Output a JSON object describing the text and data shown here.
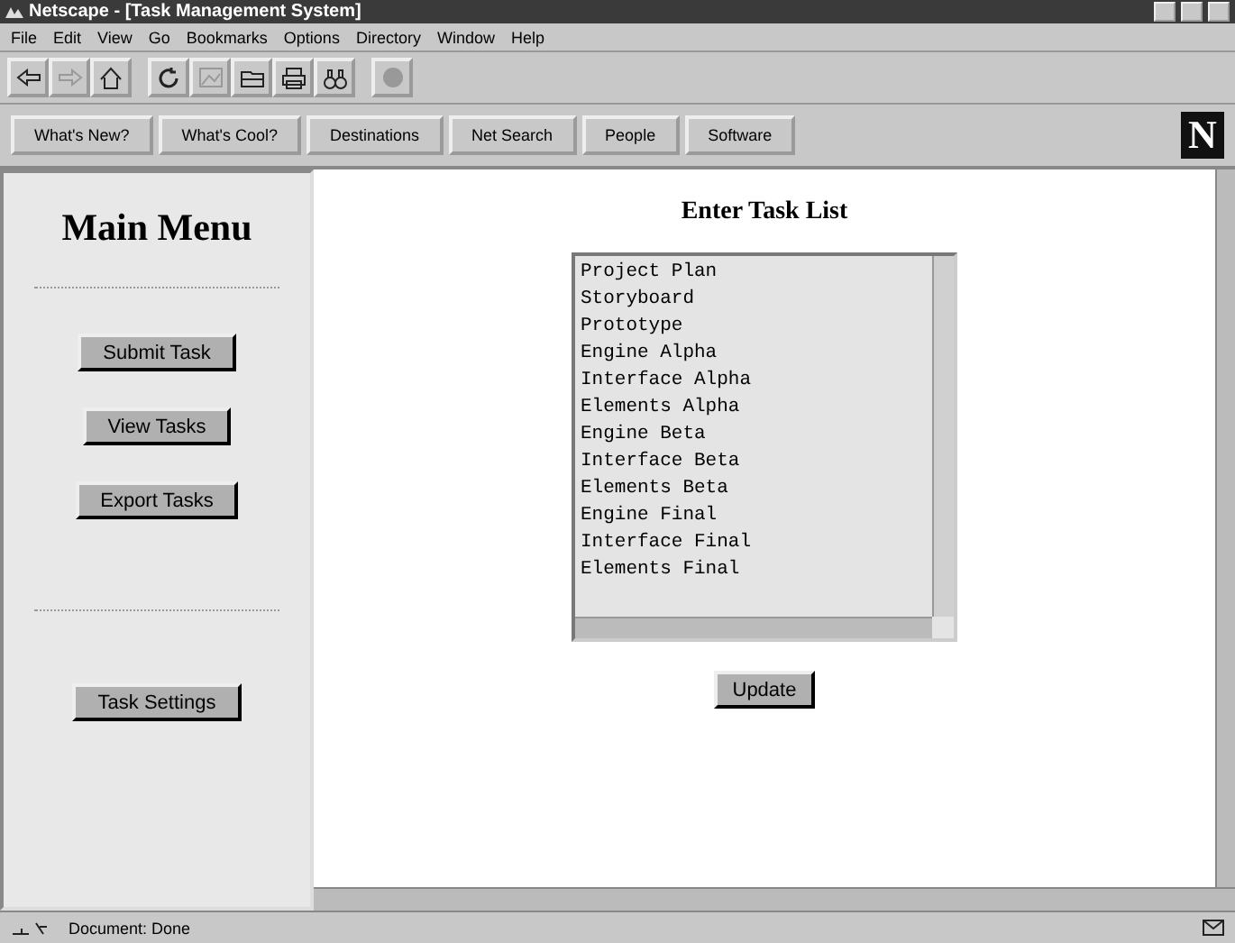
{
  "window": {
    "title": "Netscape - [Task Management System]"
  },
  "menu": [
    "File",
    "Edit",
    "View",
    "Go",
    "Bookmarks",
    "Options",
    "Directory",
    "Window",
    "Help"
  ],
  "toolbar": [
    {
      "kind": "back",
      "disabled": false
    },
    {
      "kind": "forward",
      "disabled": true
    },
    {
      "kind": "home",
      "disabled": false
    },
    {
      "kind": "reload",
      "disabled": false
    },
    {
      "kind": "images",
      "disabled": true
    },
    {
      "kind": "open",
      "disabled": false
    },
    {
      "kind": "print",
      "disabled": false
    },
    {
      "kind": "find",
      "disabled": false
    },
    {
      "kind": "stop",
      "disabled": true
    }
  ],
  "directory_buttons": [
    "What's New?",
    "What's Cool?",
    "Destinations",
    "Net Search",
    "People",
    "Software"
  ],
  "logo": "N",
  "sidebar": {
    "title": "Main Menu",
    "buttons": [
      "Submit Task",
      "View Tasks",
      "Export Tasks"
    ],
    "settings_button": "Task Settings"
  },
  "main": {
    "title": "Enter Task List",
    "tasks": [
      "Project Plan",
      "Storyboard",
      "Prototype",
      "Engine Alpha",
      "Interface Alpha",
      "Elements Alpha",
      "Engine Beta",
      "Interface Beta",
      "Elements Beta",
      "Engine Final",
      "Interface Final",
      "Elements Final"
    ],
    "button": "Update"
  },
  "status_bar": {
    "text": "Document: Done"
  }
}
